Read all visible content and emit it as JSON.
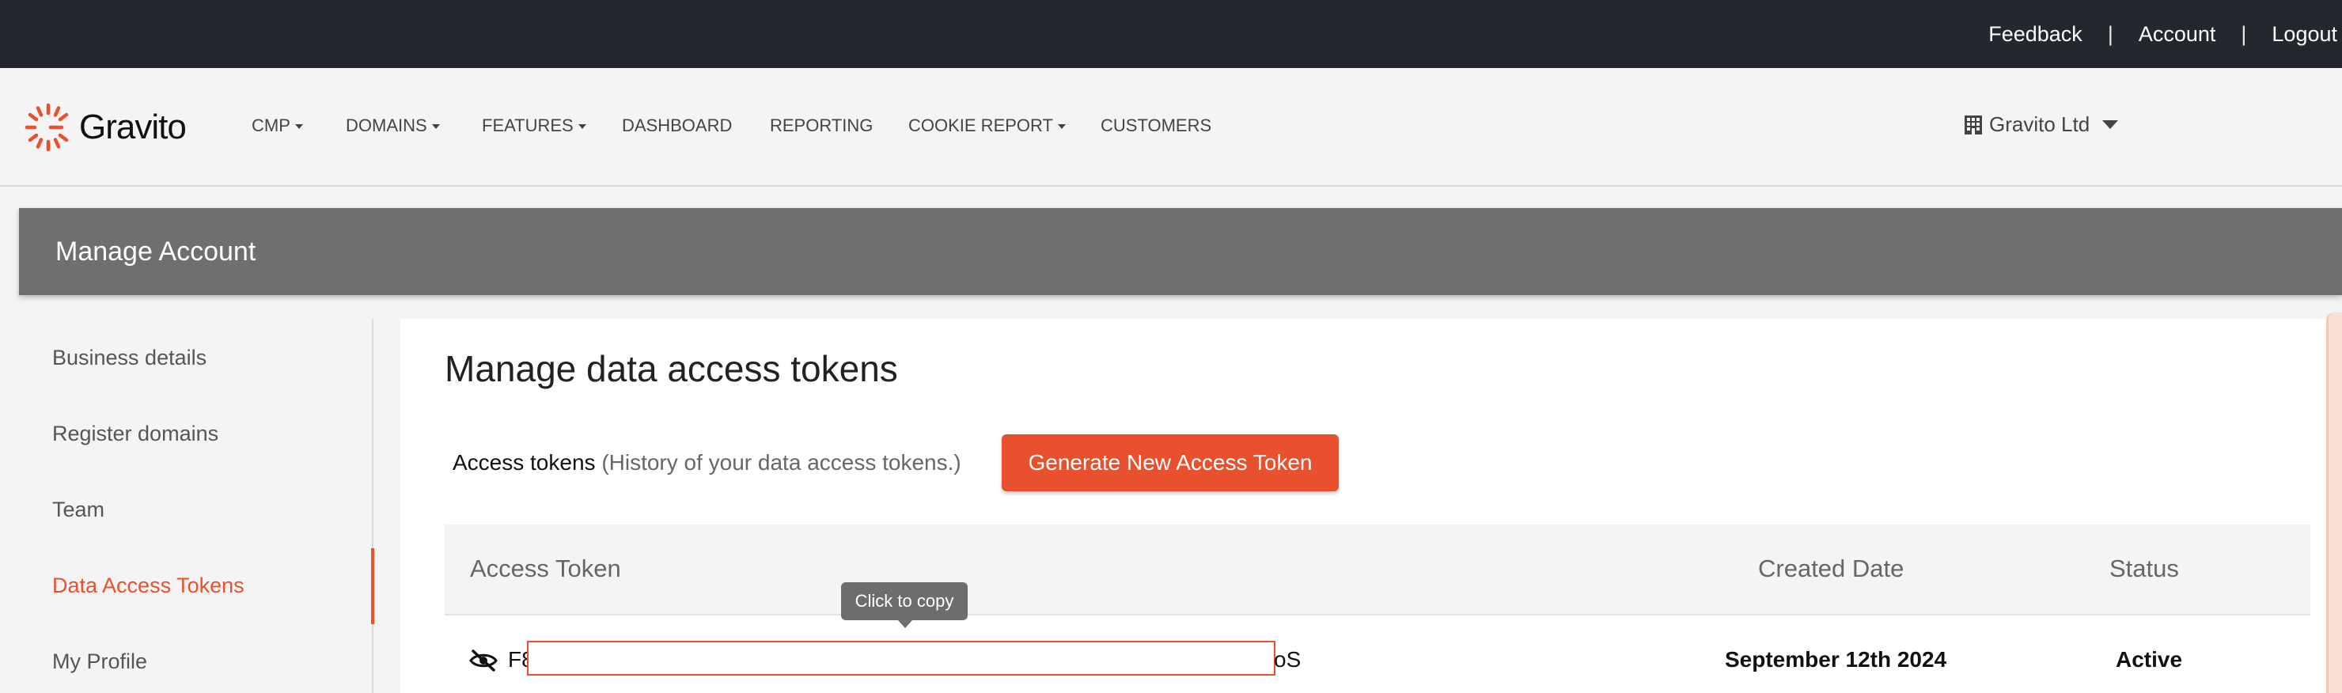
{
  "topbar": {
    "links": [
      "Feedback",
      "Account",
      "Logout"
    ],
    "separator": "|"
  },
  "brand": {
    "name": "Gravito",
    "logo_icon": "gravito-sunburst-logo",
    "accent_color": "#e9502d"
  },
  "nav": {
    "items": [
      {
        "label": "CMP",
        "dropdown": true
      },
      {
        "label": "DOMAINS",
        "dropdown": true
      },
      {
        "label": "FEATURES",
        "dropdown": true
      },
      {
        "label": "DASHBOARD",
        "dropdown": false
      },
      {
        "label": "REPORTING",
        "dropdown": false
      },
      {
        "label": "COOKIE REPORT",
        "dropdown": true
      },
      {
        "label": "CUSTOMERS",
        "dropdown": false
      }
    ],
    "organization": "Gravito Ltd",
    "organization_icon": "building-icon"
  },
  "page": {
    "header_title": "Manage Account"
  },
  "sidebar": {
    "items": [
      {
        "label": "Business details",
        "active": false
      },
      {
        "label": "Register domains",
        "active": false
      },
      {
        "label": "Team",
        "active": false
      },
      {
        "label": "Data Access Tokens",
        "active": true
      },
      {
        "label": "My Profile",
        "active": false
      }
    ]
  },
  "main": {
    "title": "Manage data access tokens",
    "tokens_label": "Access tokens",
    "tokens_hint": "(History of your data access tokens.)",
    "generate_button": "Generate New Access Token",
    "table": {
      "columns": [
        "Access Token",
        "Created Date",
        "Status"
      ],
      "rows": [
        {
          "token_prefix": "F8",
          "token_suffix": "oS",
          "created_date": "September 12th 2024",
          "status": "Active",
          "visibility_icon": "eye-slash-icon"
        }
      ]
    },
    "tooltip": "Click to copy"
  }
}
